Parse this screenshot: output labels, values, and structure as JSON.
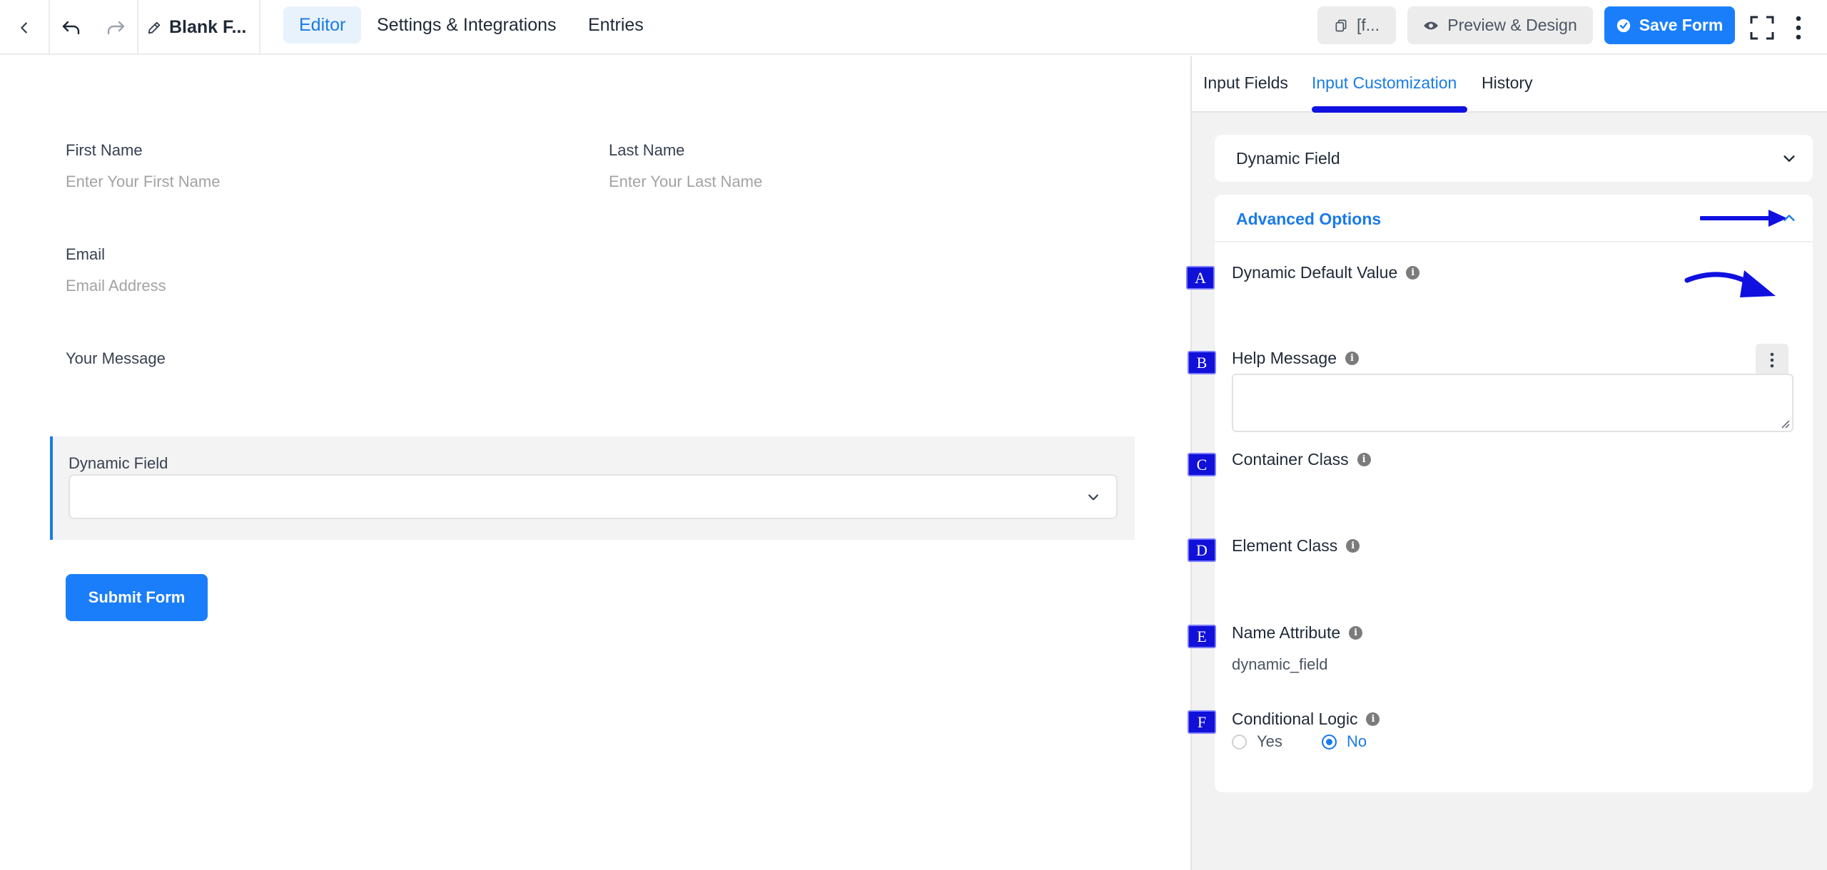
{
  "header": {
    "form_name": "Blank F...",
    "tabs": [
      {
        "label": "Editor",
        "active": true
      },
      {
        "label": "Settings & Integrations",
        "active": false
      },
      {
        "label": "Entries",
        "active": false
      }
    ],
    "shortcode_label": "[f...",
    "preview_label": "Preview & Design",
    "save_label": "Save Form"
  },
  "form": {
    "first_name": {
      "label": "First Name",
      "placeholder": "Enter Your First Name"
    },
    "last_name": {
      "label": "Last Name",
      "placeholder": "Enter Your Last Name"
    },
    "email": {
      "label": "Email",
      "placeholder": "Email Address"
    },
    "message": {
      "label": "Your Message"
    },
    "dynamic": {
      "label": "Dynamic Field"
    },
    "submit_label": "Submit Form"
  },
  "panel": {
    "tabs": [
      {
        "label": "Input Fields",
        "active": false
      },
      {
        "label": "Input Customization",
        "active": true
      },
      {
        "label": "History",
        "active": false
      }
    ],
    "dynamic_section_title": "Dynamic Field",
    "advanced_title": "Advanced Options",
    "options": {
      "dynamic_default": "Dynamic Default Value",
      "help_message": "Help Message",
      "container_class": "Container Class",
      "element_class": "Element Class",
      "name_attribute": "Name Attribute",
      "name_attribute_value": "dynamic_field",
      "conditional_logic": "Conditional Logic",
      "yes_label": "Yes",
      "no_label": "No",
      "conditional_selected": "No"
    },
    "annotations": [
      "A",
      "B",
      "C",
      "D",
      "E",
      "F"
    ]
  },
  "colors": {
    "accent": "#1a7efb",
    "annotation": "#1010e0",
    "panel_bg": "#f2f2f2"
  }
}
